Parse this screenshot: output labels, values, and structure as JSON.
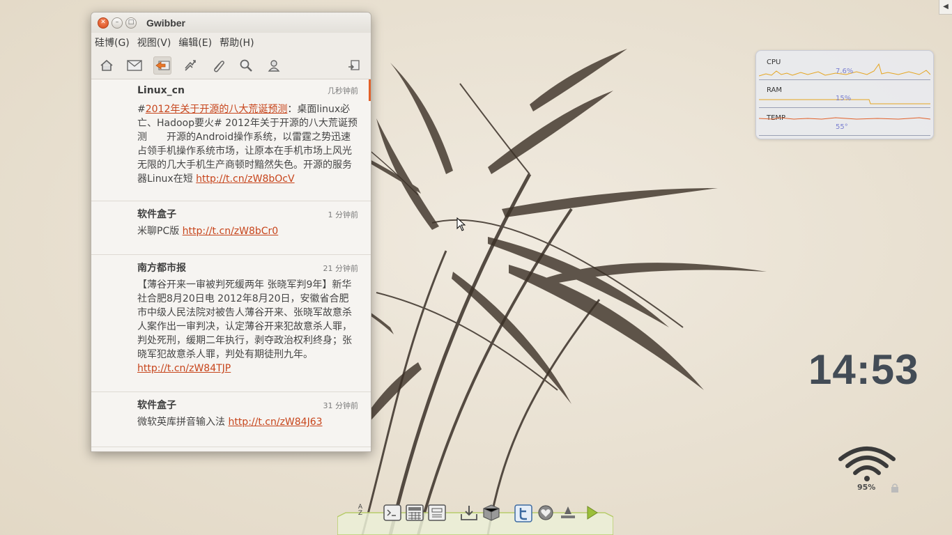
{
  "window": {
    "title": "Gwibber",
    "menu": [
      "硅博(G)",
      "视图(V)",
      "编辑(E)",
      "帮助(H)"
    ],
    "toolbar": [
      {
        "icon": "home-icon"
      },
      {
        "icon": "mail-icon"
      },
      {
        "icon": "reply-icon",
        "active": true
      },
      {
        "icon": "retweet-icon"
      },
      {
        "icon": "attachment-icon"
      },
      {
        "icon": "search-icon"
      },
      {
        "icon": "user-icon"
      },
      {
        "icon": "compose-icon"
      }
    ],
    "posts": [
      {
        "author": "Linux_cn",
        "time": "几秒钟前",
        "prefix": "#",
        "link1": "2012年关于开源的八大荒诞预测",
        "text": "：桌面linux必亡、Hadoop要火# 2012年关于开源的八大荒诞预测　　开源的Android操作系统，以雷霆之势迅速占领手机操作系统市场，让原本在手机市场上风光无限的几大手机生产商顿时黯然失色。开源的服务器Linux在短 ",
        "url": "http://t.cn/zW8bOcV"
      },
      {
        "author": "软件盒子",
        "time": "1 分钟前",
        "text": "米聊PC版 ",
        "url": "http://t.cn/zW8bCr0"
      },
      {
        "author": "南方都市报",
        "time": "21 分钟前",
        "text": "【薄谷开来一审被判死缓两年 张晓军判9年】新华社合肥8月20日电 2012年8月20日，安徽省合肥市中级人民法院对被告人薄谷开来、张晓军故意杀人案作出一审判决，认定薄谷开来犯故意杀人罪，判处死刑，缓期二年执行，剥夺政治权利终身；张晓军犯故意杀人罪，判处有期徒刑九年。",
        "url": "http://t.cn/zW84TJP"
      },
      {
        "author": "软件盒子",
        "time": "31 分钟前",
        "text": "微软英库拼音输入法 ",
        "url": "http://t.cn/zW84J63"
      }
    ]
  },
  "sysmon": {
    "cpu_label": "CPU",
    "cpu_value": "7.6%",
    "ram_label": "RAM",
    "ram_value": "15%",
    "temp_label": "TEMP",
    "temp_value": "55°"
  },
  "clock": "14:53",
  "wifi": {
    "strength": "95%"
  },
  "dock": {
    "sort_label": "A Z",
    "items": [
      "terminal-icon",
      "calculator-icon",
      "calendar-icon",
      "download-icon",
      "package-icon",
      "twitter-icon",
      "heart-icon",
      "upload-icon",
      "play-icon"
    ]
  },
  "colors": {
    "accent": "#c7451c",
    "close": "#e05a28",
    "clock": "#434c56"
  }
}
